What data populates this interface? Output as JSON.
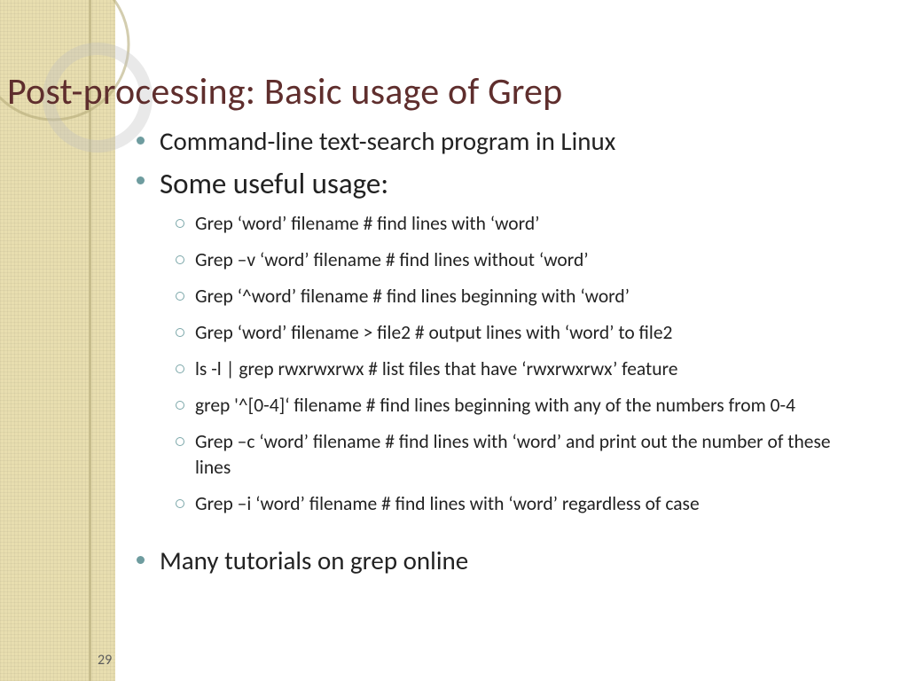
{
  "title": "Post-processing: Basic usage of Grep",
  "bullets_level1": {
    "item0": "Command-line text-search program in Linux",
    "item1": "Some useful usage:",
    "item2": "Many tutorials on grep online"
  },
  "examples": {
    "e0": "Grep ‘word’ filename    # find lines with ‘word’",
    "e1": "Grep –v ‘word’ filename # find lines without ‘word’",
    "e2": "Grep ‘^word’ filename   # find lines beginning with ‘word’",
    "e3": "Grep ‘word’ filename > file2  # output lines with ‘word’ to file2",
    "e4": "ls -l | grep rwxrwxrwx   # list files that have ‘rwxrwxrwx’ feature",
    "e5": "grep  '^[0-4]‘ filename # find lines beginning with any of the numbers from 0-4",
    "e6": "Grep –c ‘word’ filename    # find lines with ‘word’ and print out the number of these lines",
    "e7": "Grep –i ‘word’ filename  # find lines with ‘word’ regardless of case"
  },
  "slide_number": "29"
}
